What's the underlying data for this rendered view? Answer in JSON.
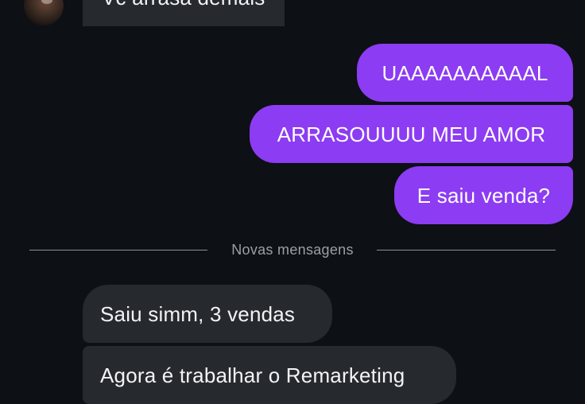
{
  "conversation": {
    "background": "#0d1014",
    "sent_color": "#8c3cf2",
    "received_color": "#262a2f",
    "avatar_icon": "contact-avatar",
    "messages_top": [
      {
        "direction": "received",
        "text": "Vc arrasa demais"
      },
      {
        "direction": "sent",
        "text": "UAAAAAAAAAAL"
      },
      {
        "direction": "sent",
        "text": "ARRASOUUUU MEU AMOR"
      },
      {
        "direction": "sent",
        "text": "E saiu venda?"
      }
    ],
    "divider": {
      "label": "Novas mensagens"
    },
    "messages_new": [
      {
        "direction": "received",
        "text": "Saiu simm, 3 vendas"
      },
      {
        "direction": "received",
        "text": "Agora é trabalhar o Remarketing"
      }
    ]
  }
}
